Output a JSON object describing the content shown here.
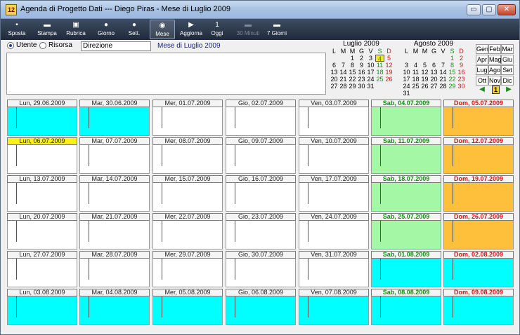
{
  "window": {
    "title": "Agenda di Progetto Dati --- Diego Piras - Mese di Luglio 2009",
    "app_icon": "l2-icon",
    "minimize": "▭",
    "maximize": "▢",
    "close": "✕"
  },
  "toolbar": [
    {
      "label": "Sposta",
      "icon": "▪",
      "name": "sposta-button"
    },
    {
      "label": "Stampa",
      "icon": "▬",
      "name": "stampa-button"
    },
    {
      "label": "Rubrica",
      "icon": "▣",
      "name": "rubrica-button"
    },
    {
      "label": "Giorno",
      "icon": "●",
      "name": "giorno-button"
    },
    {
      "label": "Sett.",
      "icon": "●",
      "name": "settimana-button"
    },
    {
      "label": "Mese",
      "icon": "◉",
      "name": "mese-button"
    },
    {
      "label": "Aggiorna",
      "icon": "▶",
      "name": "aggiorna-button"
    },
    {
      "label": "Oggi",
      "icon": "1",
      "name": "oggi-button"
    },
    {
      "label": "30 Minuti",
      "icon": "▬",
      "name": "30-minuti-button"
    },
    {
      "label": "7 Giorni",
      "icon": "▬",
      "name": "7-giorni-button"
    }
  ],
  "filter": {
    "utente_label": "Utente",
    "risorsa_label": "Risorsa",
    "risorsa_value": "Direzione",
    "month_label": "Mese di Luglio 2009"
  },
  "mini_calendars": [
    {
      "title": "Luglio 2009",
      "headers": [
        "L",
        "M",
        "M",
        "G",
        "V",
        "S",
        "D"
      ],
      "cells": [
        "",
        "",
        "1",
        "2",
        "3",
        "4",
        "5",
        "6",
        "7",
        "8",
        "9",
        "10",
        "11",
        "12",
        "13",
        "14",
        "15",
        "16",
        "17",
        "18",
        "19",
        "20",
        "21",
        "22",
        "23",
        "24",
        "25",
        "26",
        "27",
        "28",
        "29",
        "30",
        "31",
        "",
        ""
      ],
      "today_index": 5
    },
    {
      "title": "Agosto 2009",
      "headers": [
        "L",
        "M",
        "M",
        "G",
        "V",
        "S",
        "D"
      ],
      "cells": [
        "",
        "",
        "",
        "",
        "",
        "1",
        "2",
        "3",
        "4",
        "5",
        "6",
        "7",
        "8",
        "9",
        "10",
        "11",
        "12",
        "13",
        "14",
        "15",
        "16",
        "17",
        "18",
        "19",
        "20",
        "21",
        "22",
        "23",
        "24",
        "25",
        "26",
        "27",
        "28",
        "29",
        "30",
        "31",
        "",
        "",
        "",
        "",
        "",
        ""
      ],
      "today_index": -1
    }
  ],
  "months": [
    "Gen",
    "Feb",
    "Mar",
    "Apr",
    "Mag",
    "Giu",
    "Lug",
    "Ago",
    "Set",
    "Ott",
    "Nov",
    "Dic"
  ],
  "nav": {
    "prev": "◀",
    "today": "1",
    "next": "▶"
  },
  "weeks": [
    [
      "Lun, 29.06.2009",
      "Mar, 30.06.2009",
      "Mer, 01.07.2009",
      "Gio, 02.07.2009",
      "Ven, 03.07.2009",
      "Sab, 04.07.2009",
      "Dom, 05.07.2009"
    ],
    [
      "Lun, 06.07.2009",
      "Mar, 07.07.2009",
      "Mer, 08.07.2009",
      "Gio, 09.07.2009",
      "Ven, 10.07.2009",
      "Sab, 11.07.2009",
      "Dom, 12.07.2009"
    ],
    [
      "Lun, 13.07.2009",
      "Mar, 14.07.2009",
      "Mer, 15.07.2009",
      "Gio, 16.07.2009",
      "Ven, 17.07.2009",
      "Sab, 18.07.2009",
      "Dom, 19.07.2009"
    ],
    [
      "Lun, 20.07.2009",
      "Mar, 21.07.2009",
      "Mer, 22.07.2009",
      "Gio, 23.07.2009",
      "Ven, 24.07.2009",
      "Sab, 25.07.2009",
      "Dom, 26.07.2009"
    ],
    [
      "Lun, 27.07.2009",
      "Mar, 28.07.2009",
      "Mer, 29.07.2009",
      "Gio, 30.07.2009",
      "Ven, 31.07.2009",
      "Sab, 01.08.2009",
      "Dom, 02.08.2009"
    ],
    [
      "Lun, 03.08.2009",
      "Mar, 04.08.2009",
      "Mer, 05.08.2009",
      "Gio, 06.08.2009",
      "Ven, 07.08.2009",
      "Sab, 08.08.2009",
      "Dom, 09.08.2009"
    ]
  ],
  "day_colors": [
    [
      "cyan",
      "cyan",
      "white",
      "white",
      "white",
      "green",
      "orange"
    ],
    [
      "white",
      "white",
      "white",
      "white",
      "white",
      "green",
      "orange"
    ],
    [
      "white",
      "white",
      "white",
      "white",
      "white",
      "green",
      "orange"
    ],
    [
      "white",
      "white",
      "white",
      "white",
      "white",
      "green",
      "orange"
    ],
    [
      "white",
      "white",
      "white",
      "white",
      "white",
      "cyan",
      "cyan"
    ],
    [
      "cyan",
      "cyan",
      "cyan",
      "cyan",
      "cyan",
      "cyan",
      "cyan"
    ]
  ],
  "today_cell": "Lun, 06.07.2009",
  "colors": {
    "other_month": "#00ffff",
    "saturday": "#a4f7a4",
    "sunday": "#fec03a",
    "today_header": "#fbf01a"
  }
}
